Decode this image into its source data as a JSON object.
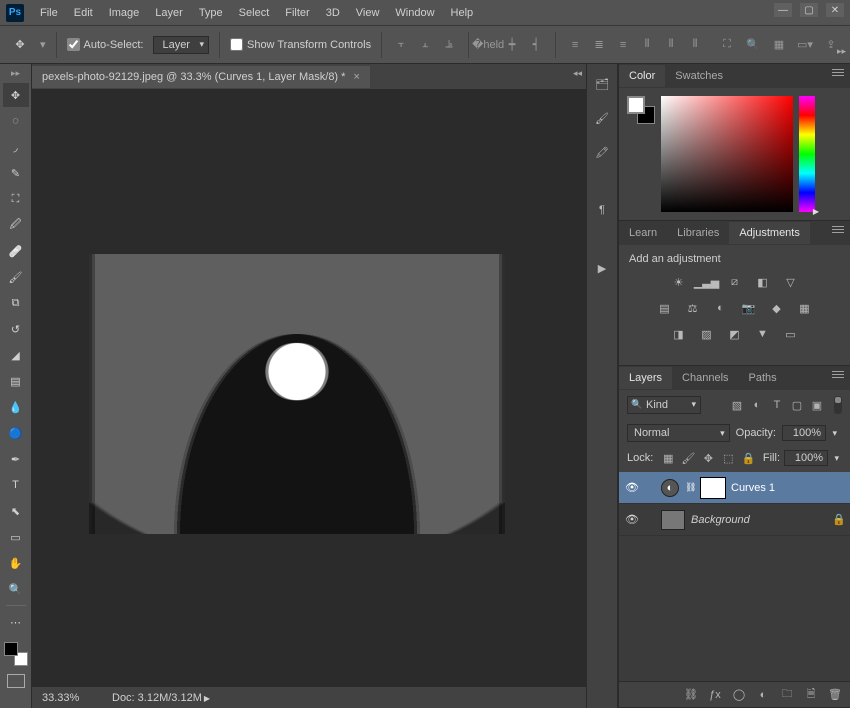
{
  "menu": {
    "items": [
      "File",
      "Edit",
      "Image",
      "Layer",
      "Type",
      "Select",
      "Filter",
      "3D",
      "View",
      "Window",
      "Help"
    ]
  },
  "window_controls": {
    "minimize": "—",
    "maximize": "▢",
    "close": "✕"
  },
  "options": {
    "auto_select_label": "Auto-Select:",
    "auto_select_target": "Layer",
    "show_transform_label": "Show Transform Controls"
  },
  "document": {
    "tab_title": "pexels-photo-92129.jpeg @ 33.3% (Curves 1, Layer Mask/8) *",
    "zoom": "33.33%",
    "doc_info": "Doc: 3.12M/3.12M"
  },
  "panels": {
    "color": {
      "tabs": [
        "Color",
        "Swatches"
      ],
      "active": 0
    },
    "libraries": {
      "tabs": [
        "Learn",
        "Libraries",
        "Adjustments"
      ],
      "active": 2,
      "heading": "Add an adjustment"
    },
    "layers": {
      "tabs": [
        "Layers",
        "Channels",
        "Paths"
      ],
      "active": 0,
      "kind_label": "Kind",
      "blend_mode": "Normal",
      "opacity_label": "Opacity:",
      "opacity_value": "100%",
      "lock_label": "Lock:",
      "fill_label": "Fill:",
      "fill_value": "100%",
      "items": [
        {
          "name": "Curves 1",
          "type": "adjustment",
          "selected": true,
          "visible": true,
          "locked": false
        },
        {
          "name": "Background",
          "type": "pixel",
          "selected": false,
          "visible": true,
          "locked": true,
          "italic": true
        }
      ]
    }
  }
}
